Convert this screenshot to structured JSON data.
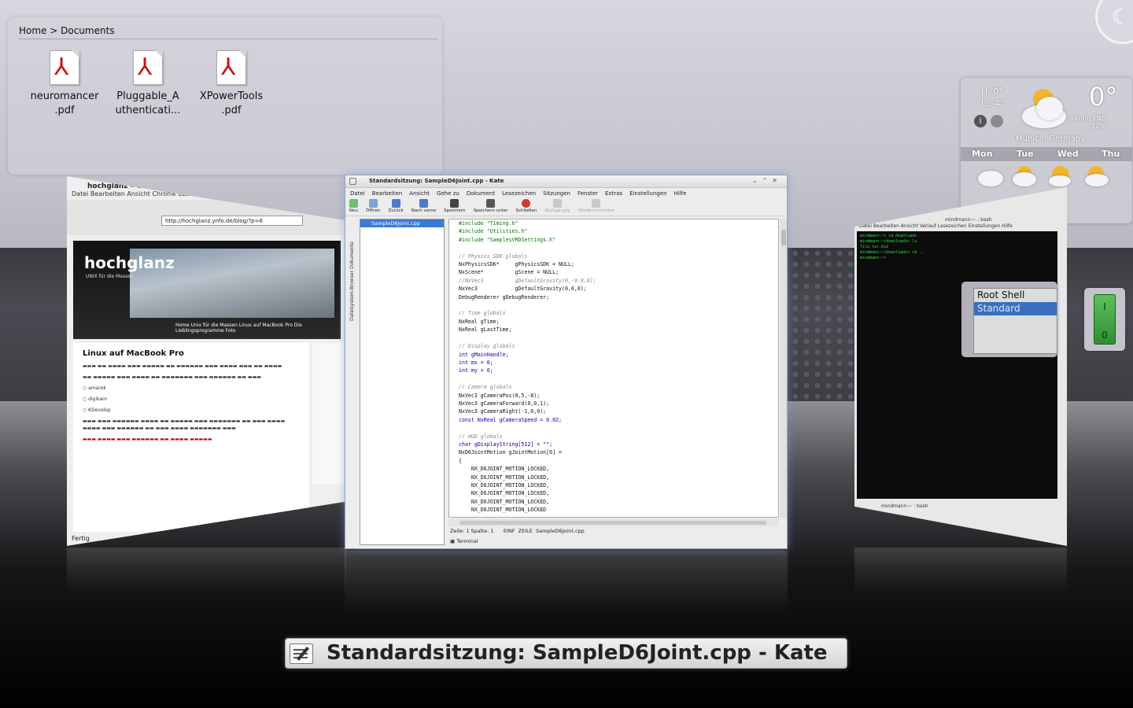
{
  "folder_view": {
    "breadcrumb": "Home > Documents",
    "files": [
      {
        "name_l1": "neuromancer",
        "name_l2": ".pdf"
      },
      {
        "name_l1": "Pluggable_A",
        "name_l2": "uthenticati..."
      },
      {
        "name_l1": "XPowerTools",
        "name_l2": ".pdf"
      }
    ]
  },
  "weather": {
    "high": "H: 0°",
    "low": "L: -4°",
    "temperature": "0°",
    "wind": "6km/h ENE",
    "humidity": "72%",
    "location": "Munich, Germany",
    "days": [
      "Mon",
      "Tue",
      "Wed",
      "Thu"
    ]
  },
  "browser": {
    "title": "hochglanz » Linux auf MacBook Pro - Mozilla Firefox",
    "menu": "Datei  Bearbeiten  Ansicht  Chronik  Lesezeichen  Extras  Hilfe",
    "url": "http://hochglanz.ynfo.de/blog/?p=6",
    "site_logo": "hochglanz",
    "site_sub": "UNIX für die Massen",
    "nav": "Home   Unix für die Massen   Linux auf MacBook Pro   Die Lieblingsprogramme   Foto",
    "article_title": "Linux auf MacBook Pro",
    "list_items": [
      "amarok",
      "digikam",
      "KDevelop"
    ],
    "status": "Fertig"
  },
  "kate": {
    "title": "Standardsitzung: SampleD6Joint.cpp - Kate",
    "menu": [
      "Datei",
      "Bearbeiten",
      "Ansicht",
      "Gehe zu",
      "Dokument",
      "Lesezeichen",
      "Sitzungen",
      "Fenster",
      "Extras",
      "Einstellungen",
      "Hilfe"
    ],
    "toolbar": {
      "new": "Neu",
      "open": "Öffnen",
      "back": "Zurück",
      "forward": "Nach vorne",
      "save": "Speichern",
      "save_as": "Speichern unter",
      "close": "Schließen",
      "undo": "Rückgängig",
      "redo": "Wiederherstellen"
    },
    "sidetabs": "Dateisystem-Browser    Dokumente",
    "open_document": "SampleD6Joint.cpp",
    "code_lines": [
      "#include \"Timing.h\"",
      "#include \"Utilities.h\"",
      "#include \"SamplesVRDSettings.h\"",
      "",
      "// Physics SDK globals",
      "NxPhysicsSDK*     gPhysicsSDK = NULL;",
      "NxScene*          gScene = NULL;",
      "//NxVec3          gDefaultGravity(0,-9.8,0);",
      "NxVec3            gDefaultGravity(0,0,0);",
      "DebugRenderer gDebugRenderer;",
      "",
      "// Time globals",
      "NxReal gTime;",
      "NxReal gLastTime;",
      "",
      "// Display globals",
      "int gMainHandle;",
      "int mx = 0;",
      "int my = 0;",
      "",
      "// Camera globals",
      "NxVec3 gCameraPos(0,5,-8);",
      "NxVec3 gCameraForward(0,0,1);",
      "NxVec3 gCameraRight(-1,0,0);",
      "const NxReal gCameraSpeed = 0.02;",
      "",
      "// HUD globals",
      "char gDisplayString[512] = \"\";",
      "NxD6JointMotion gJointMotion[6] =",
      "{",
      "    NX_D6JOINT_MOTION_LOCKED,",
      "    NX_D6JOINT_MOTION_LOCKED,",
      "    NX_D6JOINT_MOTION_LOCKED,",
      "    NX_D6JOINT_MOTION_LOCKED,",
      "    NX_D6JOINT_MOTION_LOCKED,",
      "    NX_D6JOINT_MOTION_LOCKED"
    ],
    "status": "Zeile: 1 Spalte: 1      EINF  ZEILE  SampleD6Joint.cpp",
    "terminal_tab": "Terminal"
  },
  "konsole": {
    "title": "mindmann:~ : bash",
    "menu": "Datei  Bearbeiten  Ansicht  Verlauf  Lesezeichen  Einstellungen  Hilfe",
    "lines": [
      "mindmann:~> cd downloads",
      "mindmann:~/downloads> ls",
      "file.tar.bz2",
      "mindmann:~/downloads> cd ..",
      "mindmann:~> "
    ],
    "tab": "mindmann:~ : bash"
  },
  "shells": {
    "items": [
      "Root Shell",
      "Standard"
    ],
    "selected_index": 1
  },
  "switch": {
    "on_label": "I",
    "off_label": "0"
  },
  "caption": "Standardsitzung: SampleD6Joint.cpp - Kate"
}
